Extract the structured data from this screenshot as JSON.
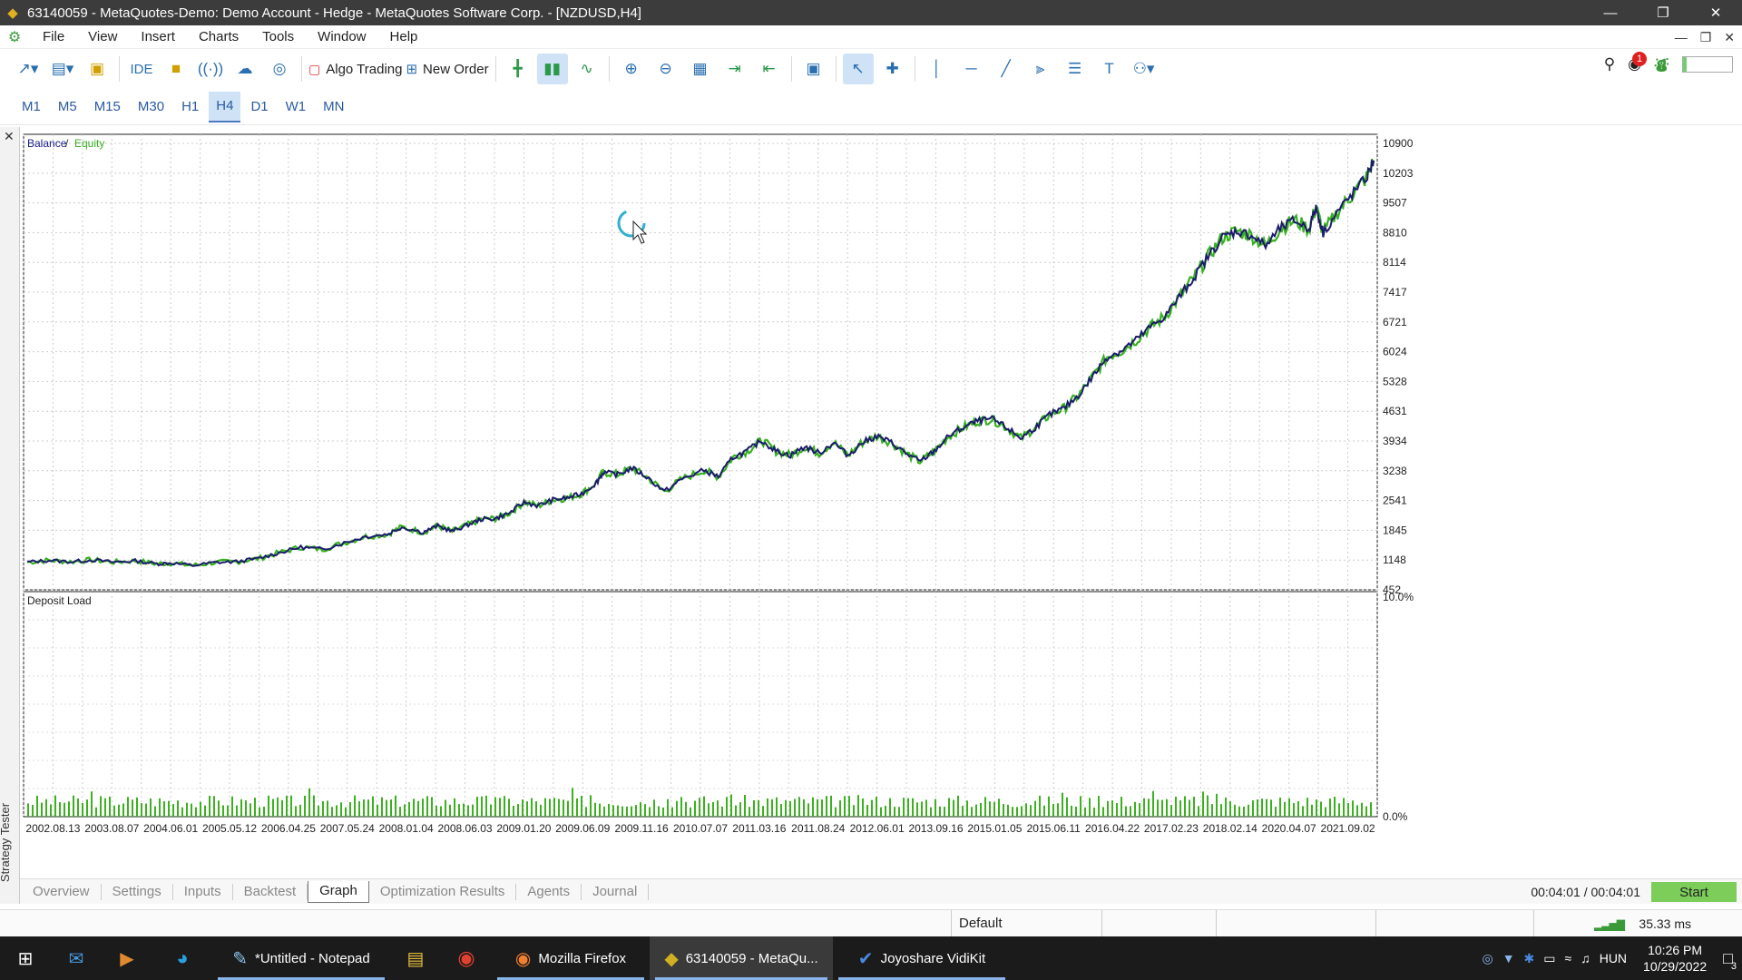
{
  "window": {
    "title": "63140059 - MetaQuotes-Demo: Demo Account - Hedge - MetaQuotes Software Corp. - [NZDUSD,H4]"
  },
  "menu": [
    "File",
    "View",
    "Insert",
    "Charts",
    "Tools",
    "Window",
    "Help"
  ],
  "toolbar": {
    "ide_label": "IDE",
    "algo_label": "Algo Trading",
    "order_label": "New Order",
    "notif_count": "1",
    "level_fraction": 0.08
  },
  "timeframes": [
    "M1",
    "M5",
    "M15",
    "M30",
    "H1",
    "H4",
    "D1",
    "W1",
    "MN"
  ],
  "active_timeframe": "H4",
  "chart_data": [
    {
      "type": "line",
      "title": "Balance / Equity",
      "series": [
        {
          "name": "Balance",
          "color": "#1c1c6c"
        },
        {
          "name": "Equity",
          "color": "#38b020"
        }
      ],
      "yticks": [
        "10900",
        "10203",
        "9507",
        "8810",
        "8114",
        "7417",
        "6721",
        "6024",
        "5328",
        "4631",
        "3934",
        "3238",
        "2541",
        "1845",
        "1148",
        "452"
      ],
      "ylim": [
        452,
        10900
      ],
      "xticks": [
        "2002.08.13",
        "2003.08.07",
        "2004.06.01",
        "2005.05.12",
        "2006.04.25",
        "2007.05.24",
        "2008.01.04",
        "2008.06.03",
        "2009.01.20",
        "2009.06.09",
        "2009.11.16",
        "2010.07.07",
        "2011.03.16",
        "2011.08.24",
        "2012.06.01",
        "2013.09.16",
        "2015.01.05",
        "2015.06.11",
        "2016.04.22",
        "2017.02.23",
        "2018.02.14",
        "2020.04.07",
        "2021.09.02"
      ],
      "points": [
        [
          0,
          1100
        ],
        [
          0.03,
          1140
        ],
        [
          0.06,
          1110
        ],
        [
          0.09,
          1150
        ],
        [
          0.12,
          1100
        ],
        [
          0.15,
          1130
        ],
        [
          0.18,
          1060
        ],
        [
          0.2,
          1080
        ],
        [
          0.23,
          1020
        ],
        [
          0.26,
          1090
        ],
        [
          0.29,
          1110
        ],
        [
          0.32,
          1180
        ],
        [
          0.35,
          1320
        ],
        [
          0.38,
          1450
        ],
        [
          0.41,
          1400
        ],
        [
          0.44,
          1550
        ],
        [
          0.47,
          1700
        ],
        [
          0.5,
          1750
        ],
        [
          0.52,
          1920
        ],
        [
          0.55,
          1800
        ],
        [
          0.57,
          1950
        ],
        [
          0.59,
          1820
        ],
        [
          0.61,
          1960
        ],
        [
          0.63,
          2100
        ],
        [
          0.65,
          2120
        ],
        [
          0.67,
          2250
        ],
        [
          0.69,
          2500
        ],
        [
          0.71,
          2420
        ],
        [
          0.73,
          2560
        ],
        [
          0.75,
          2600
        ],
        [
          0.77,
          2700
        ],
        [
          0.79,
          2950
        ],
        [
          0.8,
          3200
        ],
        [
          0.82,
          3150
        ],
        [
          0.84,
          3300
        ],
        [
          0.86,
          3100
        ],
        [
          0.885,
          2750
        ],
        [
          0.91,
          3050
        ],
        [
          0.94,
          3250
        ],
        [
          0.96,
          3100
        ],
        [
          0.98,
          3550
        ],
        [
          1.0,
          3700
        ],
        [
          1.02,
          3950
        ],
        [
          1.04,
          3700
        ],
        [
          1.06,
          3600
        ],
        [
          1.08,
          3800
        ],
        [
          1.1,
          3650
        ],
        [
          1.12,
          3900
        ],
        [
          1.14,
          3600
        ],
        [
          1.16,
          3900
        ],
        [
          1.18,
          4050
        ],
        [
          1.2,
          3900
        ],
        [
          1.22,
          3650
        ],
        [
          1.24,
          3450
        ],
        [
          1.26,
          3700
        ],
        [
          1.28,
          4050
        ],
        [
          1.3,
          4250
        ],
        [
          1.32,
          4400
        ],
        [
          1.34,
          4450
        ],
        [
          1.36,
          4250
        ],
        [
          1.38,
          4000
        ],
        [
          1.4,
          4250
        ],
        [
          1.42,
          4550
        ],
        [
          1.44,
          4700
        ],
        [
          1.46,
          5000
        ],
        [
          1.48,
          5450
        ],
        [
          1.5,
          5900
        ],
        [
          1.52,
          6050
        ],
        [
          1.54,
          6300
        ],
        [
          1.56,
          6600
        ],
        [
          1.58,
          6850
        ],
        [
          1.6,
          7300
        ],
        [
          1.62,
          7750
        ],
        [
          1.64,
          8250
        ],
        [
          1.66,
          8700
        ],
        [
          1.68,
          8850
        ],
        [
          1.7,
          8750
        ],
        [
          1.72,
          8500
        ],
        [
          1.74,
          8900
        ],
        [
          1.76,
          9100
        ],
        [
          1.78,
          8900
        ],
        [
          1.79,
          9400
        ],
        [
          1.8,
          8800
        ],
        [
          1.82,
          9300
        ],
        [
          1.84,
          9700
        ],
        [
          1.86,
          10100
        ],
        [
          1.87,
          10500
        ]
      ],
      "x_span": 1.87
    },
    {
      "type": "bar",
      "title": "Deposit Load",
      "ylim": [
        "0.0%",
        "10.0%"
      ],
      "color": "#3cb020"
    }
  ],
  "bottom_tabs": [
    "Overview",
    "Settings",
    "Inputs",
    "Backtest",
    "Graph",
    "Optimization Results",
    "Agents",
    "Journal"
  ],
  "active_tab": "Graph",
  "strategy_tester_label": "Strategy Tester",
  "elapsed": "00:04:01 / 00:04:01",
  "start_label": "Start",
  "status": {
    "profile": "Default",
    "ping": "35.33 ms"
  },
  "taskbar": {
    "items": [
      {
        "name": "notepad",
        "label": "*Untitled - Notepad"
      },
      {
        "name": "firefox",
        "label": "Mozilla Firefox"
      },
      {
        "name": "metatrader",
        "label": "63140059 - MetaQu..."
      },
      {
        "name": "vidikit",
        "label": "Joyoshare VidiKit"
      }
    ],
    "lang": "HUN",
    "time": "10:26 PM",
    "date": "10/29/2022",
    "notif": "3"
  }
}
